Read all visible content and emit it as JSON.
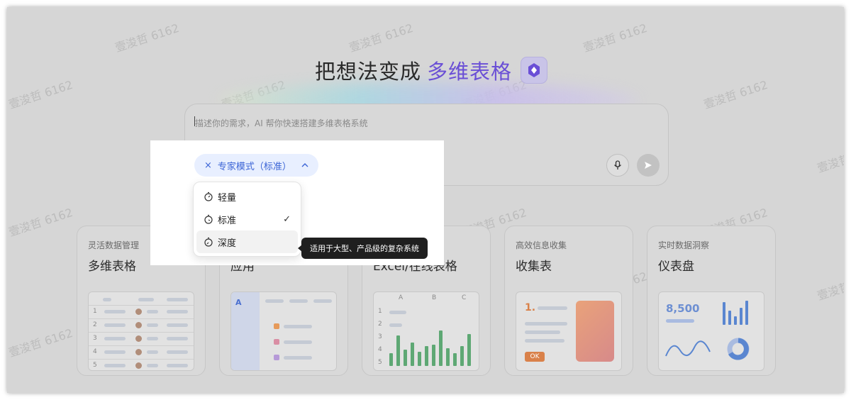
{
  "header": {
    "title_prefix": "把想法变成",
    "title_accent": "多维表格"
  },
  "prompt": {
    "placeholder": "描述你的需求，AI 帮你快速搭建多维表格系统"
  },
  "mode_chip": {
    "close_glyph": "×",
    "label": "专家模式（标准）",
    "caret": "^"
  },
  "mode_menu": {
    "items": [
      {
        "label": "轻量",
        "selected": false
      },
      {
        "label": "标准",
        "selected": true
      },
      {
        "label": "深度",
        "selected": false
      }
    ],
    "check_glyph": "✓"
  },
  "tooltip": {
    "text": "适用于大型、产品级的复杂系统"
  },
  "cards": [
    {
      "subtitle": "灵活数据管理",
      "title": "多维表格"
    },
    {
      "subtitle": "",
      "title": "应用"
    },
    {
      "subtitle": "",
      "title": "Excel/在线表格"
    },
    {
      "subtitle": "高效信息收集",
      "title": "收集表"
    },
    {
      "subtitle": "实时数据洞察",
      "title": "仪表盘"
    }
  ],
  "thumbs": {
    "sheet_rows": [
      "1",
      "2",
      "3",
      "4",
      "5"
    ],
    "excel_cols": [
      "A",
      "B",
      "C"
    ],
    "excel_rows": [
      "1",
      "2",
      "3",
      "4",
      "5"
    ],
    "excel_bars": [
      0.35,
      0.85,
      0.45,
      0.65,
      0.4,
      0.55,
      0.6,
      1.0,
      0.5,
      0.35,
      0.55,
      0.9
    ],
    "form_step": "1.",
    "form_button": "OK",
    "dashboard_value": "8,500"
  },
  "watermark": "壹浚哲 6162",
  "colors": {
    "accent_purple": "#6a4fd6",
    "chip_blue": "#3b64d6",
    "tooltip_bg": "#1f1f1f"
  },
  "icons": {
    "mic": "mic-icon",
    "send": "send-icon",
    "close": "close-icon",
    "chevron": "chevron-up-icon",
    "check": "check-icon",
    "timer": "timer-icon",
    "logo": "app-logo-icon"
  }
}
